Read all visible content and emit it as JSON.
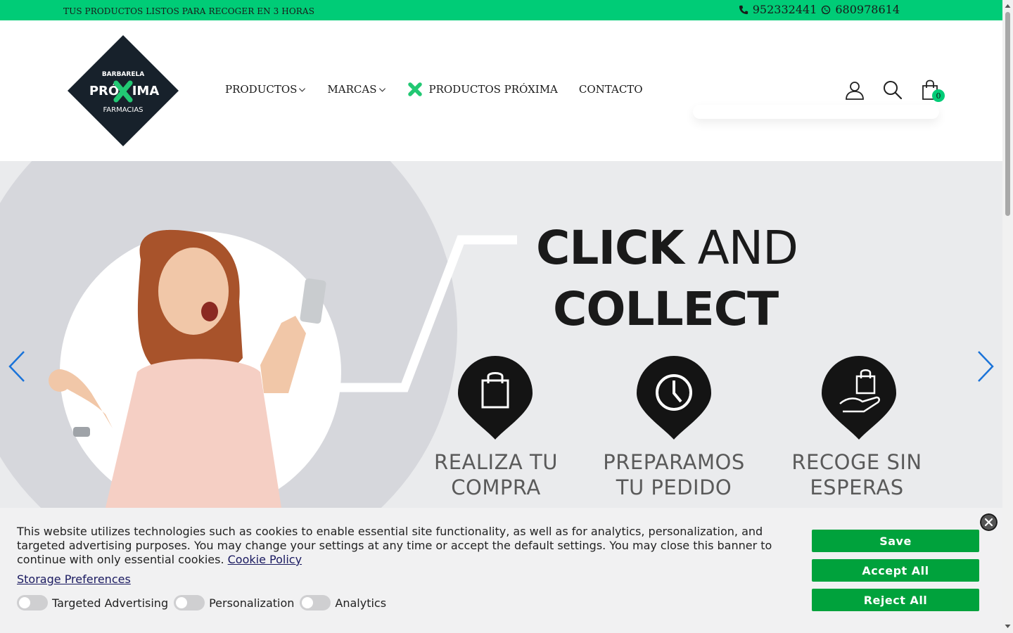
{
  "topbar": {
    "promo": "TUS PRODUCTOS LISTOS PARA RECOGER EN 3 HORAS",
    "phone": "952332441",
    "whatsapp": "680978614"
  },
  "logo": {
    "top": "BARBARELA",
    "middle_left": "PRÓ",
    "middle_right": "IMA",
    "bottom": "FARMACIAS"
  },
  "nav": {
    "items": [
      {
        "label": "PRODUCTOS",
        "icon": "chevron-down-icon"
      },
      {
        "label": "MARCAS",
        "icon": "chevron-down-icon"
      },
      {
        "label": "PRODUCTOS PRÓXIMA",
        "icon": "green-cross-icon"
      },
      {
        "label": "CONTACTO"
      }
    ]
  },
  "header_icons": {
    "account": "user-icon",
    "search": "search-icon",
    "cart": "shopping-bag-icon",
    "cart_count": "0"
  },
  "hero": {
    "headline_bold": "CLICK",
    "headline_light": "AND",
    "headline2": "COLLECT",
    "steps": [
      {
        "label": "REALIZA TU\nCOMPRA",
        "icon": "shopping-bag-icon"
      },
      {
        "label": "PREPARAMOS\nTU PEDIDO",
        "icon": "clock-icon"
      },
      {
        "label": "RECOGE SIN\nESPERAS",
        "icon": "hand-bag-icon"
      }
    ]
  },
  "cookie": {
    "message": "This website utilizes technologies such as cookies to enable essential site functionality, as well as for analytics, personalization, and targeted advertising purposes. You may change your settings at any time or accept the default settings. You may close this banner to continue with only essential cookies.",
    "policy_link": "Cookie Policy",
    "storage_link": "Storage Preferences",
    "toggles": [
      "Targeted Advertising",
      "Personalization",
      "Analytics"
    ],
    "buttons": {
      "save": "Save",
      "accept": "Accept All",
      "reject": "Reject All"
    }
  },
  "colors": {
    "brand_green": "#00cc77",
    "button_green": "#00a23c",
    "logo_dark": "#17212b"
  }
}
